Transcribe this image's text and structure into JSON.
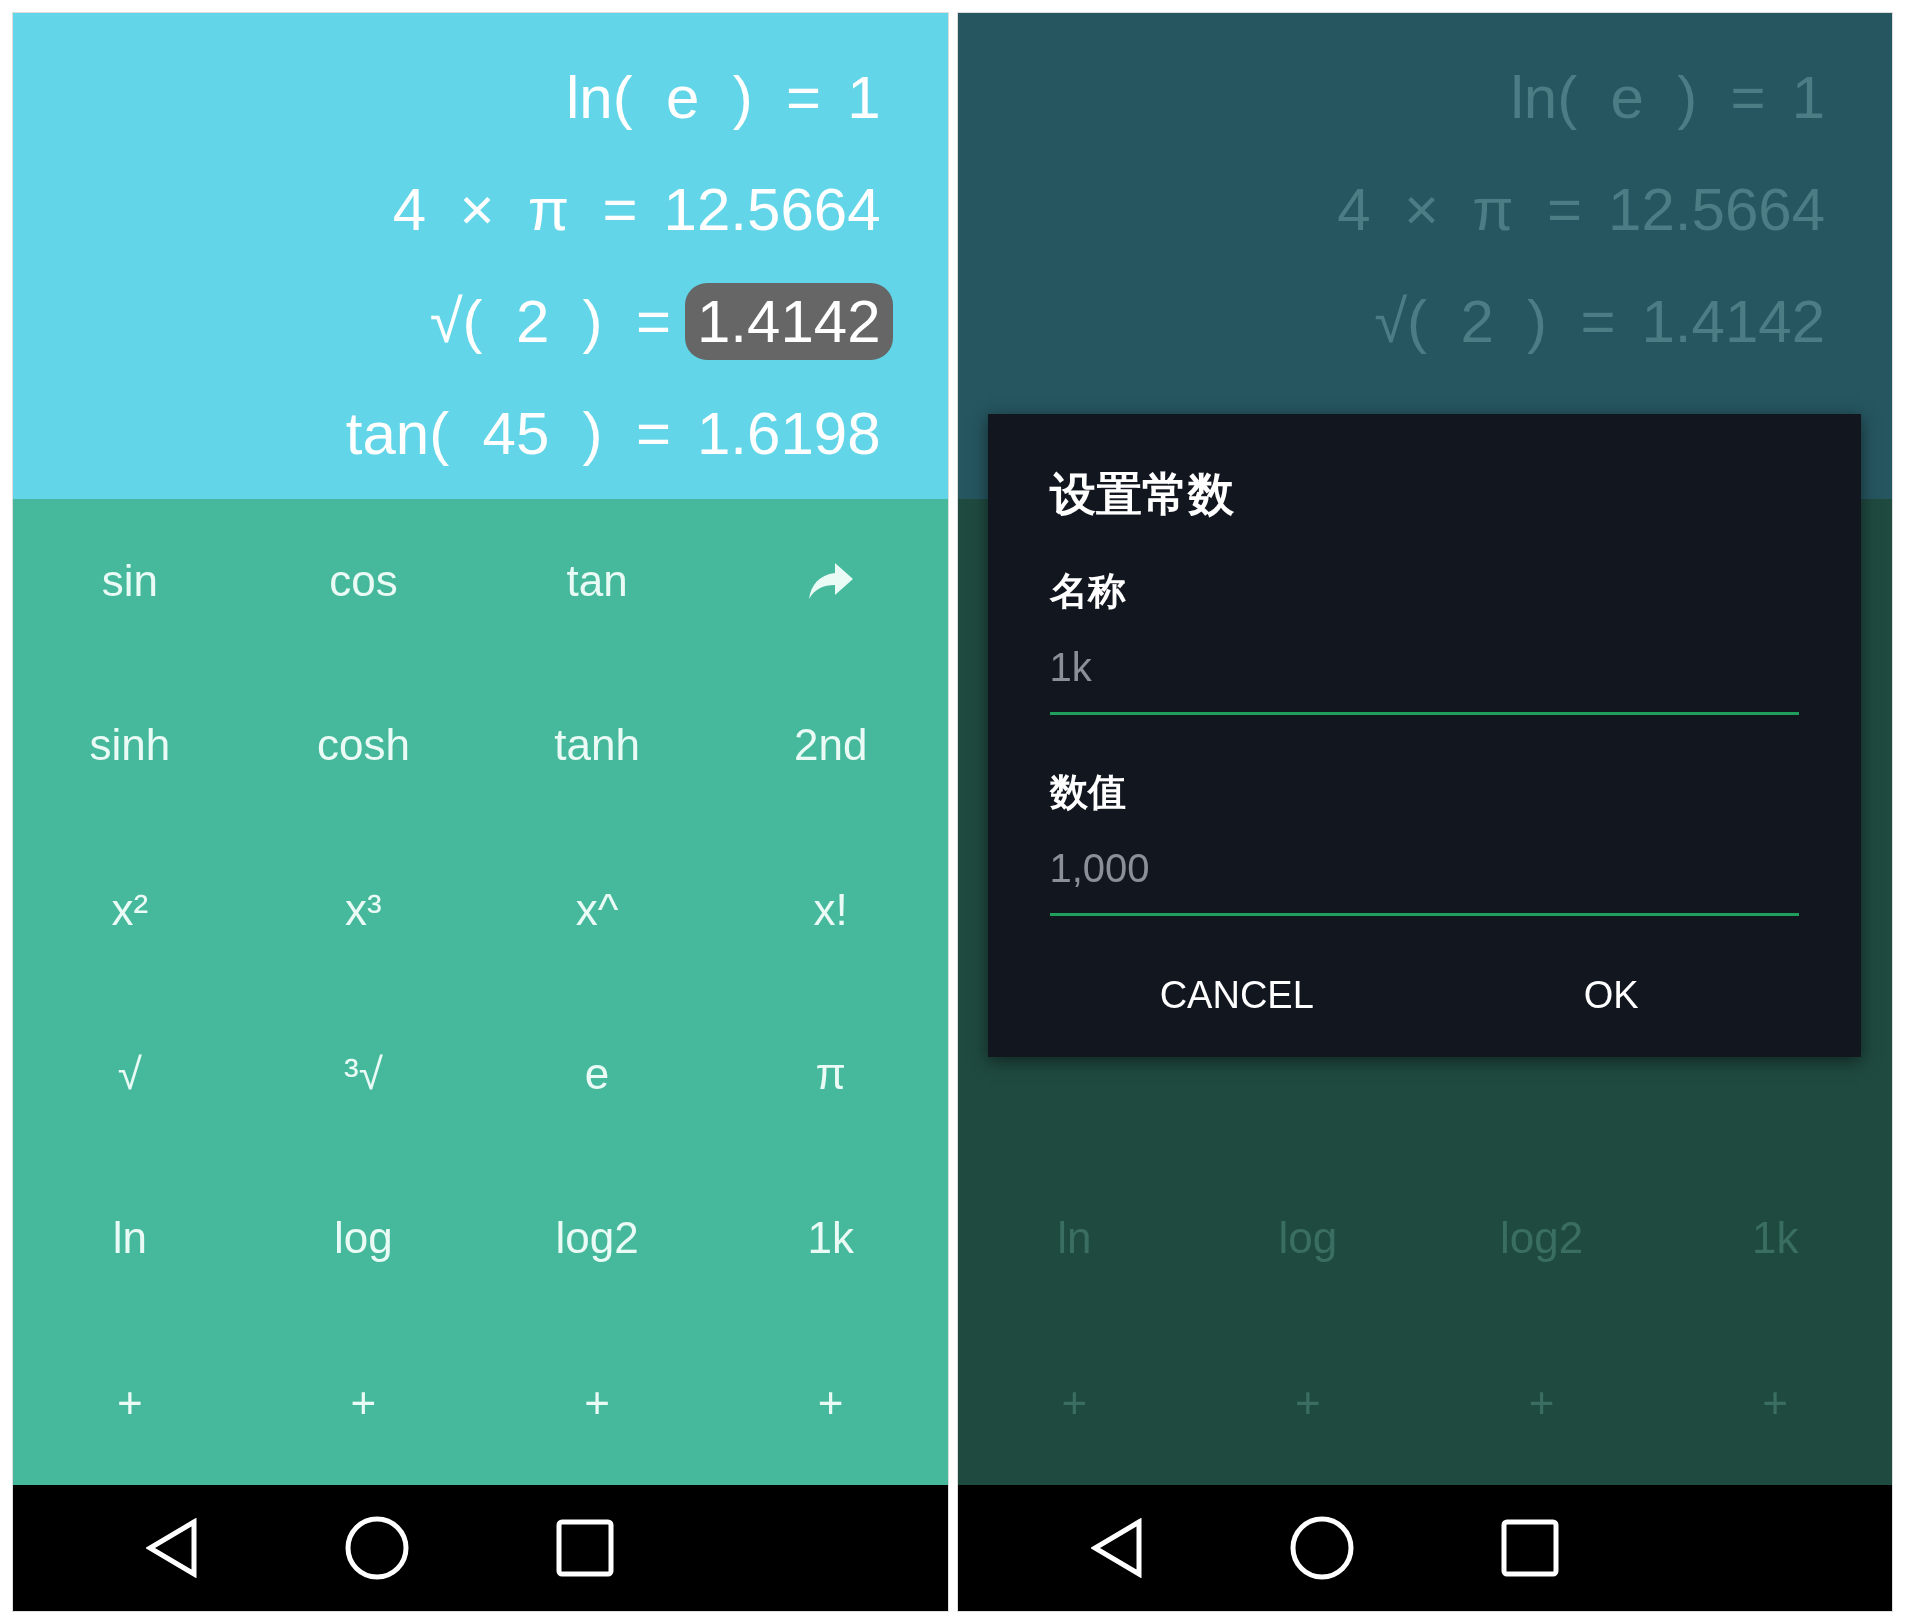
{
  "left_screen": {
    "history": [
      {
        "expression": "ln(  e  )  =",
        "result": "1",
        "selected": false
      },
      {
        "expression": "4  ×  π  =",
        "result": "12.5664",
        "selected": false
      },
      {
        "expression": "√(  2  )  =",
        "result": "1.4142",
        "selected": true
      },
      {
        "expression": "tan(  45  )  =",
        "result": "1.6198",
        "selected": false
      }
    ],
    "keys": [
      [
        {
          "kind": "text",
          "label": "sin"
        },
        {
          "kind": "text",
          "label": "cos"
        },
        {
          "kind": "text",
          "label": "tan"
        },
        {
          "kind": "share"
        }
      ],
      [
        {
          "kind": "text",
          "label": "sinh"
        },
        {
          "kind": "text",
          "label": "cosh"
        },
        {
          "kind": "text",
          "label": "tanh"
        },
        {
          "kind": "text",
          "label": "2nd"
        }
      ],
      [
        {
          "kind": "text",
          "label": "x²"
        },
        {
          "kind": "text",
          "label": "x³"
        },
        {
          "kind": "text",
          "label": "x^"
        },
        {
          "kind": "text",
          "label": "x!"
        }
      ],
      [
        {
          "kind": "text",
          "label": "√"
        },
        {
          "kind": "text",
          "label": "³√"
        },
        {
          "kind": "text",
          "label": "e"
        },
        {
          "kind": "text",
          "label": "π"
        }
      ],
      [
        {
          "kind": "text",
          "label": "ln"
        },
        {
          "kind": "text",
          "label": "log"
        },
        {
          "kind": "text",
          "label": "log2"
        },
        {
          "kind": "text",
          "label": "1k"
        }
      ],
      [
        {
          "kind": "text",
          "label": "+"
        },
        {
          "kind": "text",
          "label": "+"
        },
        {
          "kind": "text",
          "label": "+"
        },
        {
          "kind": "text",
          "label": "+"
        }
      ]
    ]
  },
  "right_screen": {
    "history": [
      {
        "expression": "ln(  e  )  =",
        "result": "1",
        "selected": false
      },
      {
        "expression": "4  ×  π  =",
        "result": "12.5664",
        "selected": false
      },
      {
        "expression": "√(  2  )  =",
        "result": "1.4142",
        "selected": false
      }
    ],
    "keys": [
      [
        {
          "kind": "text",
          "label": "ln"
        },
        {
          "kind": "text",
          "label": "log"
        },
        {
          "kind": "text",
          "label": "log2"
        },
        {
          "kind": "text",
          "label": "1k"
        }
      ],
      [
        {
          "kind": "text",
          "label": "+"
        },
        {
          "kind": "text",
          "label": "+"
        },
        {
          "kind": "text",
          "label": "+"
        },
        {
          "kind": "text",
          "label": "+"
        }
      ]
    ],
    "dialog": {
      "title": "设置常数",
      "fields": [
        {
          "label": "名称",
          "value": "1k"
        },
        {
          "label": "数值",
          "value": "1,000"
        }
      ],
      "buttons": [
        "CANCEL",
        "OK"
      ]
    }
  }
}
